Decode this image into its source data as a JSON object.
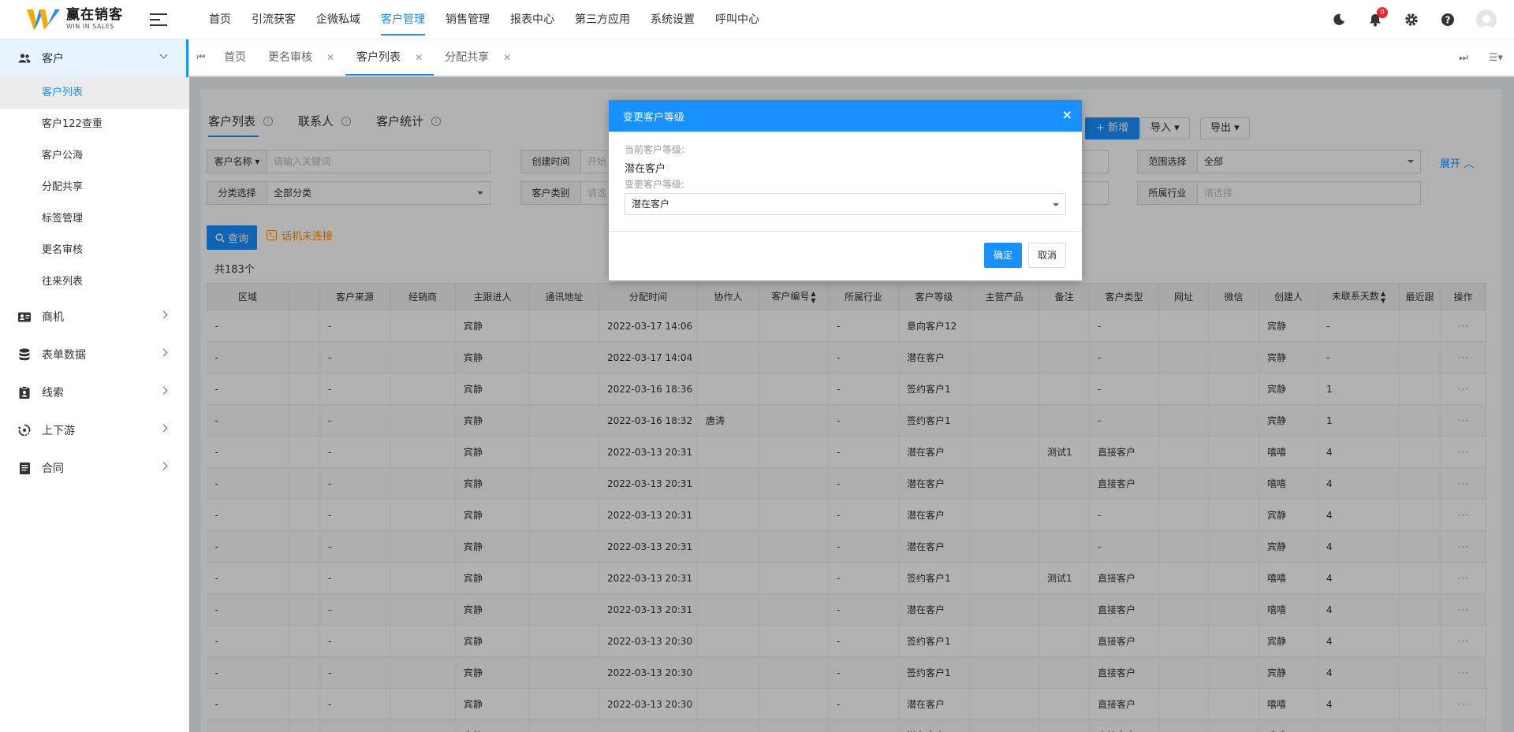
{
  "brand": {
    "name": "赢在销客",
    "tagline": "WIN IN SALES"
  },
  "topnav": [
    "首页",
    "引流获客",
    "企微私域",
    "客户管理",
    "销售管理",
    "报表中心",
    "第三方应用",
    "系统设置",
    "呼叫中心"
  ],
  "topnav_active_index": 3,
  "notifications": {
    "count": "0"
  },
  "sidebar": {
    "groups": [
      {
        "label": "客户",
        "icon": "users-icon",
        "open": true,
        "items": [
          "客户列表",
          "客户122查重",
          "客户公海",
          "分配共享",
          "标签管理",
          "更名审核",
          "往来列表"
        ],
        "active_item": 0
      },
      {
        "label": "商机",
        "icon": "id-card-icon",
        "open": false
      },
      {
        "label": "表单数据",
        "icon": "database-icon",
        "open": false
      },
      {
        "label": "线索",
        "icon": "clipboard-icon",
        "open": false
      },
      {
        "label": "上下游",
        "icon": "cycle-icon",
        "open": false
      },
      {
        "label": "合同",
        "icon": "document-icon",
        "open": false
      }
    ]
  },
  "tabs": [
    {
      "label": "首页",
      "closable": false,
      "active": false
    },
    {
      "label": "更名审核",
      "closable": true,
      "active": false
    },
    {
      "label": "客户列表",
      "closable": true,
      "active": true
    },
    {
      "label": "分配共享",
      "closable": true,
      "active": false
    }
  ],
  "subtabs": [
    "客户列表",
    "联系人",
    "客户统计"
  ],
  "actions": {
    "add": "+ 新增",
    "import": "导入",
    "export": "导出"
  },
  "filters": {
    "customer_name": {
      "label": "客户名称",
      "placeholder": "请输入关键词"
    },
    "created_time": {
      "label": "创建时间",
      "placeholder": "开始"
    },
    "range": {
      "label": "范围选择",
      "value": "全部"
    },
    "category": {
      "label": "分类选择",
      "value": "全部分类"
    },
    "customer_type": {
      "label": "客户类别",
      "placeholder": "请选"
    },
    "industry": {
      "label": "所属行业",
      "placeholder": "请选择"
    },
    "expand": "展开"
  },
  "query_button": "查询",
  "phone_status": "话机未连接",
  "total": "共183个",
  "table": {
    "columns": [
      "区域",
      "",
      "客户来源",
      "经销商",
      "主跟进人",
      "通讯地址",
      "分配时间",
      "协作人",
      "客户编号",
      "所属行业",
      "客户等级",
      "主营产品",
      "备注",
      "客户类型",
      "网址",
      "微信",
      "创建人",
      "未联系天数",
      "最近跟",
      "操作"
    ],
    "rows": [
      [
        "-",
        "",
        "-",
        "",
        "宾静",
        "",
        "2022-03-17 14:06",
        "",
        "",
        "-",
        "意向客户12",
        "",
        "",
        "-",
        "",
        "",
        "宾静",
        "-",
        "",
        "···"
      ],
      [
        "-",
        "",
        "-",
        "",
        "宾静",
        "",
        "2022-03-17 14:04",
        "",
        "",
        "-",
        "潜在客户",
        "",
        "",
        "-",
        "",
        "",
        "宾静",
        "-",
        "",
        "···"
      ],
      [
        "-",
        "",
        "-",
        "",
        "宾静",
        "",
        "2022-03-16 18:36",
        "",
        "",
        "-",
        "签约客户1",
        "",
        "",
        "-",
        "",
        "",
        "宾静",
        "1",
        "",
        "···"
      ],
      [
        "-",
        "",
        "-",
        "",
        "宾静",
        "",
        "2022-03-16 18:32",
        "唐涛",
        "",
        "-",
        "签约客户1",
        "",
        "",
        "-",
        "",
        "",
        "宾静",
        "1",
        "",
        "···"
      ],
      [
        "-",
        "",
        "-",
        "",
        "宾静",
        "",
        "2022-03-13 20:31",
        "",
        "",
        "-",
        "潜在客户",
        "",
        "测试1",
        "直接客户",
        "",
        "",
        "嘻嘻",
        "4",
        "",
        "···"
      ],
      [
        "-",
        "",
        "-",
        "",
        "宾静",
        "",
        "2022-03-13 20:31",
        "",
        "",
        "-",
        "潜在客户",
        "",
        "",
        "直接客户",
        "",
        "",
        "嘻嘻",
        "4",
        "",
        "···"
      ],
      [
        "-",
        "",
        "-",
        "",
        "宾静",
        "",
        "2022-03-13 20:31",
        "",
        "",
        "-",
        "潜在客户",
        "",
        "",
        "-",
        "",
        "",
        "宾静",
        "4",
        "",
        "···"
      ],
      [
        "-",
        "",
        "-",
        "",
        "宾静",
        "",
        "2022-03-13 20:31",
        "",
        "",
        "-",
        "潜在客户",
        "",
        "",
        "-",
        "",
        "",
        "宾静",
        "4",
        "",
        "···"
      ],
      [
        "-",
        "",
        "-",
        "",
        "宾静",
        "",
        "2022-03-13 20:31",
        "",
        "",
        "-",
        "签约客户1",
        "",
        "测试1",
        "直接客户",
        "",
        "",
        "嘻嘻",
        "4",
        "",
        "···"
      ],
      [
        "-",
        "",
        "-",
        "",
        "宾静",
        "",
        "2022-03-13 20:31",
        "",
        "",
        "-",
        "潜在客户",
        "",
        "",
        "直接客户",
        "",
        "",
        "嘻嘻",
        "4",
        "",
        "···"
      ],
      [
        "-",
        "",
        "-",
        "",
        "宾静",
        "",
        "2022-03-13 20:30",
        "",
        "",
        "-",
        "签约客户1",
        "",
        "",
        "直接客户",
        "",
        "",
        "宾静",
        "4",
        "",
        "···"
      ],
      [
        "-",
        "",
        "-",
        "",
        "宾静",
        "",
        "2022-03-13 20:30",
        "",
        "",
        "-",
        "签约客户1",
        "",
        "",
        "直接客户",
        "",
        "",
        "宾静",
        "4",
        "",
        "···"
      ],
      [
        "-",
        "",
        "-",
        "",
        "宾静",
        "",
        "2022-03-13 20:30",
        "",
        "",
        "-",
        "潜在客户",
        "",
        "",
        "直接客户",
        "",
        "",
        "嘻嘻",
        "4",
        "",
        "···"
      ],
      [
        "-",
        "",
        "-",
        "",
        "宾静",
        "",
        "2022-03-13 20:30",
        "",
        "",
        "-",
        "潜在客户",
        "",
        "",
        "直接客户",
        "",
        "",
        "嘻嘻",
        "4",
        "",
        "···"
      ]
    ]
  },
  "modal": {
    "title": "变更客户等级",
    "current_label": "当前客户等级:",
    "current_value": "潜在客户",
    "change_label": "变更客户等级:",
    "selected": "潜在客户",
    "ok": "确定",
    "cancel": "取消"
  },
  "colors": {
    "primary": "#1890ff",
    "badge": "#f5222d",
    "warning": "#ff8c00"
  }
}
